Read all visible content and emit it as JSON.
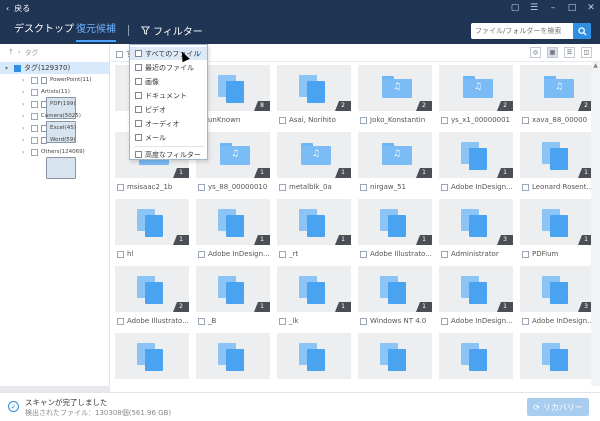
{
  "titlebar": {
    "back_label": "戻る",
    "back_icon": "chevron-left-icon"
  },
  "header": {
    "tabs": [
      {
        "label": "デスクトップ"
      },
      {
        "label": "復元候補"
      }
    ],
    "filter_label": "フィルター",
    "search_placeholder": "ファイル/フォルダーを検索"
  },
  "breadcrumb": {
    "path": "タグ"
  },
  "tree": {
    "root": {
      "label": "タグ(129370)"
    },
    "items": [
      {
        "label": "PowerPoint(11)"
      },
      {
        "label": "Artists(11)"
      },
      {
        "label": "PDF(199)"
      },
      {
        "label": "Camera(5025)"
      },
      {
        "label": "Excel(45)"
      },
      {
        "label": "Word(59)"
      },
      {
        "label": "Others(124069)"
      }
    ]
  },
  "toolbar": {
    "select_all_hint": "す"
  },
  "filter_menu": {
    "items": [
      {
        "label": "すべてのファイル"
      },
      {
        "label": "最近のファイル"
      },
      {
        "label": "画像"
      },
      {
        "label": "ドキュメント"
      },
      {
        "label": "ビデオ"
      },
      {
        "label": "オーディオ"
      },
      {
        "label": "メール"
      },
      {
        "label": "高度なフィルター"
      }
    ],
    "selected": "すべてのファイル"
  },
  "grid": {
    "rows": [
      [
        {
          "name": "",
          "count": "",
          "icon": "doc"
        },
        {
          "name": "unKnown",
          "count": "8",
          "icon": "doc"
        },
        {
          "name": "Asai, Norihito",
          "count": "2",
          "icon": "doc"
        },
        {
          "name": "Joko_Konstantin",
          "count": "2",
          "icon": "folder"
        },
        {
          "name": "ys_x1_00000001",
          "count": "2",
          "icon": "folder"
        },
        {
          "name": "xava_88_00000",
          "count": "2",
          "icon": "folder"
        }
      ],
      [
        {
          "name": "msisaac2_1b",
          "count": "1",
          "icon": "folder"
        },
        {
          "name": "ys_88_00000010",
          "count": "1",
          "icon": "folder"
        },
        {
          "name": "metalblk_0a",
          "count": "1",
          "icon": "folder"
        },
        {
          "name": "nirgaw_51",
          "count": "1",
          "icon": "folder"
        },
        {
          "name": "Adobe InDesign...",
          "count": "1",
          "icon": "doc"
        },
        {
          "name": "Leonard Rosent...",
          "count": "1",
          "icon": "doc"
        }
      ],
      [
        {
          "name": "hl",
          "count": "1",
          "icon": "doc"
        },
        {
          "name": "Adobe InDesign...",
          "count": "1",
          "icon": "doc"
        },
        {
          "name": "_rt",
          "count": "1",
          "icon": "doc"
        },
        {
          "name": "Adobe Illustrato...",
          "count": "1",
          "icon": "doc"
        },
        {
          "name": "Administrator",
          "count": "3",
          "icon": "doc"
        },
        {
          "name": "PDFium",
          "count": "1",
          "icon": "doc"
        }
      ],
      [
        {
          "name": "Adobe Illustrato...",
          "count": "2",
          "icon": "doc"
        },
        {
          "name": "_B",
          "count": "1",
          "icon": "doc"
        },
        {
          "name": "_lk",
          "count": "1",
          "icon": "doc"
        },
        {
          "name": "Windows NT 4.0",
          "count": "1",
          "icon": "doc"
        },
        {
          "name": "Adobe InDesign...",
          "count": "1",
          "icon": "doc"
        },
        {
          "name": "Adobe InDesign...",
          "count": "3",
          "icon": "doc"
        }
      ],
      [
        {
          "name": "",
          "count": "",
          "icon": "doc"
        },
        {
          "name": "",
          "count": "",
          "icon": "doc"
        },
        {
          "name": "",
          "count": "",
          "icon": "doc"
        },
        {
          "name": "",
          "count": "",
          "icon": "doc"
        },
        {
          "name": "",
          "count": "",
          "icon": "doc"
        },
        {
          "name": "",
          "count": "",
          "icon": "doc"
        }
      ]
    ]
  },
  "footer": {
    "status_title": "スキャンが完了しました",
    "status_detail": "検出されたファイル：130308個(561.96 GB)",
    "recover_label": "リカバリー"
  },
  "colors": {
    "header_bg": "#1f3553",
    "accent": "#2f8fe3",
    "tile_bg": "#eceef0"
  }
}
